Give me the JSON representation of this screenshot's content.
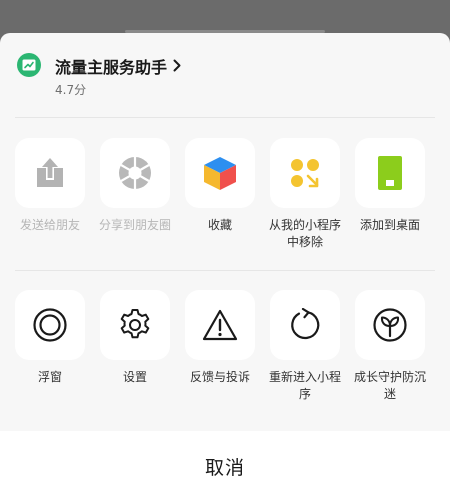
{
  "app": {
    "name": "流量主服务助手",
    "rating": "4.7分"
  },
  "row1": [
    {
      "label": "发送给朋友",
      "icon": "share-out-icon",
      "disabled": true
    },
    {
      "label": "分享到朋友圈",
      "icon": "moments-aperture-icon",
      "disabled": true
    },
    {
      "label": "收藏",
      "icon": "favorites-cube-icon",
      "disabled": false
    },
    {
      "label": "从我的小程序中移除",
      "icon": "remove-miniprogram-icon",
      "disabled": false
    },
    {
      "label": "添加到桌面",
      "icon": "add-to-desktop-icon",
      "disabled": false
    }
  ],
  "row2": [
    {
      "label": "浮窗",
      "icon": "floating-window-icon",
      "disabled": false
    },
    {
      "label": "设置",
      "icon": "gear-icon",
      "disabled": false
    },
    {
      "label": "反馈与投诉",
      "icon": "warning-triangle-icon",
      "disabled": false
    },
    {
      "label": "重新进入小程序",
      "icon": "reload-icon",
      "disabled": false
    },
    {
      "label": "成长守护防沉迷",
      "icon": "sprout-icon",
      "disabled": false
    }
  ],
  "cancel_label": "取消",
  "colors": {
    "logo_green": "#2bb672",
    "favorites_blue": "#2d8ff0",
    "favorites_red": "#f0504c",
    "favorites_yellow": "#f5b82e",
    "remove_yellow": "#f4c430",
    "desktop_green": "#8ccd1c",
    "disabled_gray": "#b6b6b6"
  }
}
